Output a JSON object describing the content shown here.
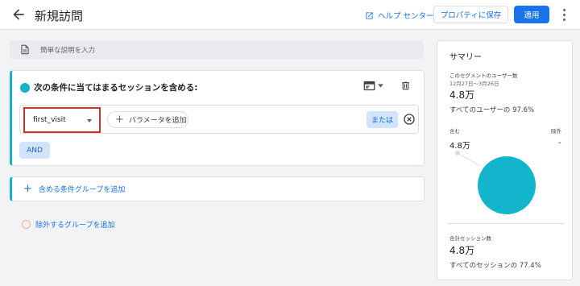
{
  "header": {
    "title": "新規訪問",
    "help_label": "ヘルプ センター",
    "save_label": "プロパティに保存",
    "apply_label": "適用"
  },
  "description": {
    "placeholder": "簡単な説明を入力"
  },
  "condition_group": {
    "title": "次の条件に当てはまるセッションを含める:",
    "selected_event": "first_visit",
    "add_param_label": "パラメータを追加",
    "or_label": "または",
    "and_label": "AND"
  },
  "add_include_group_label": "含める条件グループを追加",
  "add_exclude_group_label": "除外するグループを追加",
  "summary": {
    "title": "サマリー",
    "users_label": "このセグメントのユーザー数",
    "date_range": "12月27日～3月26日",
    "users_value": "4.8万",
    "users_pct_text": "すべてのユーザーの 97.6%",
    "include_label": "含む",
    "exclude_label": "除外",
    "include_value": "4.8万",
    "exclude_value": "-",
    "sessions_label": "合計セッション数",
    "sessions_value": "4.8万",
    "sessions_pct_text": "すべてのセッションの 77.4%",
    "accent_color": "#12b5cb"
  },
  "icons": [
    "back-arrow-icon",
    "external-link-icon",
    "more-vert-icon",
    "document-icon",
    "card-view-icon",
    "delete-icon",
    "cancel-circle-icon",
    "plus-icon"
  ]
}
